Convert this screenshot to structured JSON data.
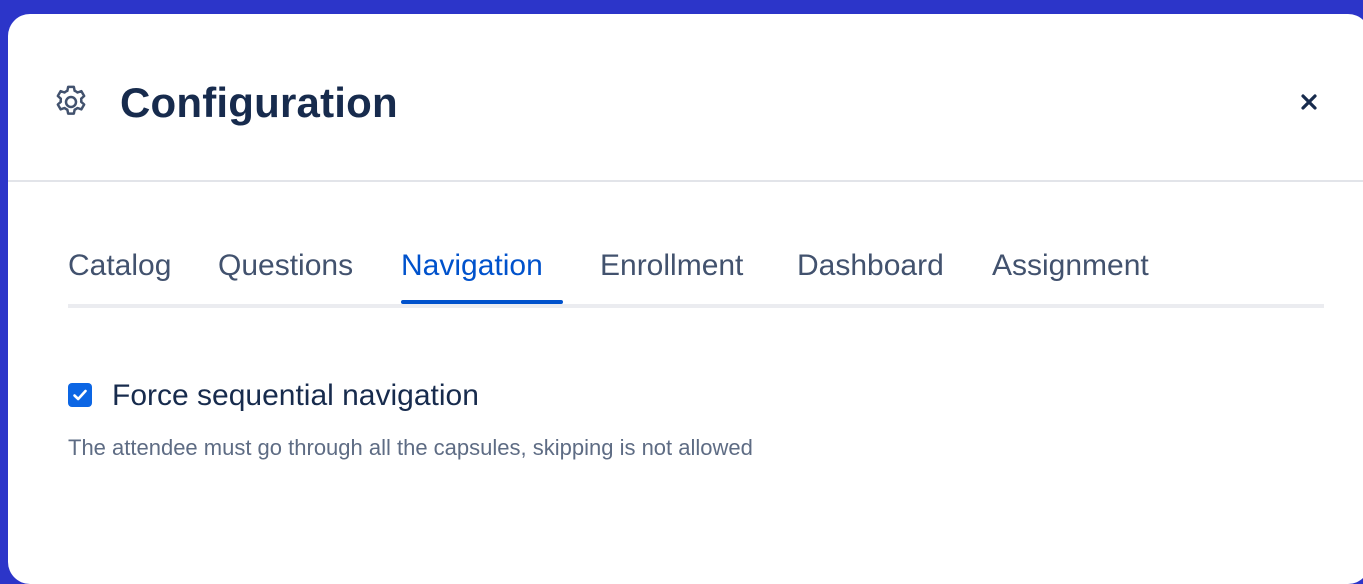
{
  "dialog": {
    "title": "Configuration",
    "icon": "gear-icon",
    "close_icon": "close-icon",
    "close_symbol": "×"
  },
  "tabs": [
    {
      "label": "Catalog",
      "active": false
    },
    {
      "label": "Questions",
      "active": false
    },
    {
      "label": "Navigation",
      "active": true
    },
    {
      "label": "Enrollment",
      "active": false
    },
    {
      "label": "Dashboard",
      "active": false
    },
    {
      "label": "Assignment",
      "active": false
    }
  ],
  "navigation": {
    "force_sequential": {
      "checked": true,
      "label": "Force sequential navigation",
      "description": "The attendee must go through all the capsules, skipping is not allowed"
    }
  },
  "colors": {
    "backdrop": "#2c35c9",
    "accent": "#0052cc",
    "checkbox": "#0c66e4",
    "title": "#172b4d",
    "tab_text": "#42526e",
    "muted_text": "#5e6c84"
  }
}
